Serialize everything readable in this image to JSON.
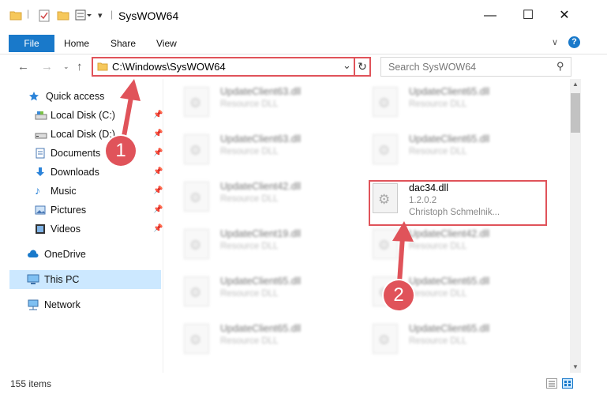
{
  "window": {
    "title": "SysWOW64",
    "controls": {
      "minimize": "—",
      "maximize": "☐",
      "close": "✕"
    },
    "help_icon": "?",
    "collapse_icon": "∨"
  },
  "ribbon": {
    "file_tab": "File",
    "tabs": [
      "Home",
      "Share",
      "View"
    ]
  },
  "address_bar": {
    "path": "C:\\Windows\\SysWOW64",
    "dropdown_icon": "⌄",
    "refresh_icon": "↻"
  },
  "search": {
    "placeholder": "Search SysWOW64",
    "icon": "⚲"
  },
  "sidebar": {
    "items": [
      {
        "label": "Quick access",
        "icon": "star-icon",
        "pinned": false
      },
      {
        "label": "Local Disk (C:)",
        "icon": "drive-icon",
        "pinned": true
      },
      {
        "label": "Local Disk (D:)",
        "icon": "drive-icon",
        "pinned": true
      },
      {
        "label": "Documents",
        "icon": "documents-icon",
        "pinned": true
      },
      {
        "label": "Downloads",
        "icon": "downloads-icon",
        "pinned": true
      },
      {
        "label": "Music",
        "icon": "music-icon",
        "pinned": true
      },
      {
        "label": "Pictures",
        "icon": "pictures-icon",
        "pinned": true
      },
      {
        "label": "Videos",
        "icon": "videos-icon",
        "pinned": true
      },
      {
        "label": "OneDrive",
        "icon": "cloud-icon",
        "pinned": false
      },
      {
        "label": "This PC",
        "icon": "computer-icon",
        "pinned": false,
        "selected": true
      },
      {
        "label": "Network",
        "icon": "network-icon",
        "pinned": false
      }
    ]
  },
  "files": {
    "left_column": [
      {
        "name": "UpdateClient63.dll",
        "type": "Resource DLL"
      },
      {
        "name": "UpdateClient63.dll",
        "type": "Resource DLL"
      },
      {
        "name": "UpdateClient42.dll",
        "type": "Resource DLL"
      },
      {
        "name": "UpdateClient19.dll",
        "type": "Resource DLL"
      },
      {
        "name": "UpdateClient65.dll",
        "type": "Resource DLL"
      },
      {
        "name": "UpdateClient65.dll",
        "type": "Resource DLL"
      }
    ],
    "right_column": [
      {
        "name": "UpdateClient65.dll",
        "type": "Resource DLL"
      },
      {
        "name": "UpdateClient65.dll",
        "type": "Resource DLL"
      },
      {
        "name": "UpdateClient42.dll",
        "type": "Resource DLL"
      },
      {
        "name": "UpdateClient65.dll",
        "type": "Resource DLL"
      },
      {
        "name": "UpdateClient65.dll",
        "type": "Resource DLL"
      }
    ],
    "highlighted": {
      "name": "dac34.dll",
      "version": "1.2.0.2",
      "company": "Christoph Schmelnik..."
    }
  },
  "annotations": {
    "step1": "1",
    "step2": "2",
    "accent": "#e0535a"
  },
  "status": {
    "item_count": "155 items"
  }
}
